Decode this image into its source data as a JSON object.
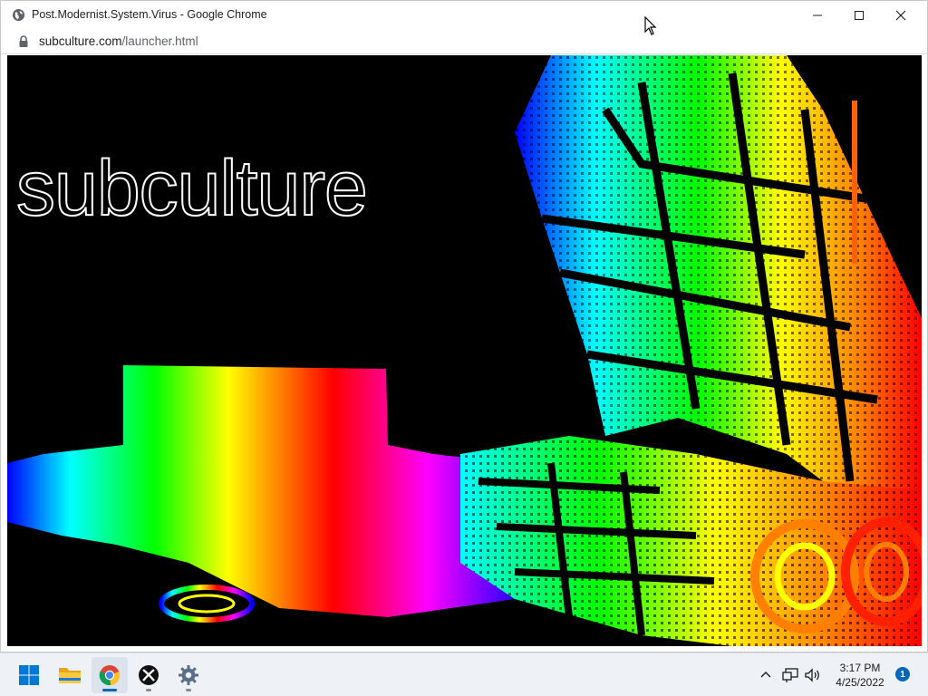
{
  "window": {
    "title": "Post.Modernist.System.Virus - Google Chrome",
    "app_icon": "globe-icon",
    "controls": {
      "minimize": "minimize-icon",
      "maximize": "maximize-icon",
      "close": "close-icon"
    }
  },
  "address_bar": {
    "lock_icon": "lock-icon",
    "url_host": "subculture.com",
    "url_path": "/launcher.html"
  },
  "page": {
    "logo_text": "subculture",
    "artwork": "rainbow-gradient truck illustration",
    "background_color": "#000000"
  },
  "taskbar": {
    "apps": [
      {
        "name": "Start",
        "icon": "windows-start-icon",
        "active": false
      },
      {
        "name": "File Explorer",
        "icon": "folder-icon",
        "active": false
      },
      {
        "name": "Google Chrome",
        "icon": "chrome-icon",
        "active": true
      },
      {
        "name": "Xbox",
        "icon": "xbox-icon",
        "active": false
      },
      {
        "name": "Settings",
        "icon": "gear-icon",
        "active": false
      }
    ],
    "tray": {
      "chevron": "chevron-up-icon",
      "network": "network-icon",
      "volume": "volume-icon",
      "time": "3:17 PM",
      "date": "4/25/2022",
      "notification_count": "1"
    }
  },
  "colors": {
    "accent": "#0067c0",
    "rainbow": [
      "#0000ff",
      "#00ffff",
      "#00ff00",
      "#ffff00",
      "#ff0000",
      "#ff00ff"
    ]
  }
}
